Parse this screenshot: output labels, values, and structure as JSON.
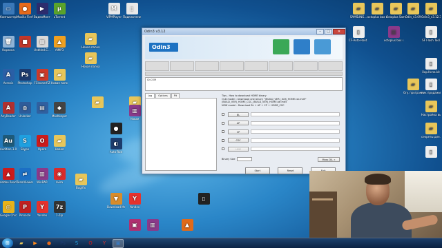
{
  "desktop": {
    "icons_left": [
      {
        "label": "Компьютер",
        "color": "#3a78b8",
        "glyph": "▭",
        "icon": "computer-icon"
      },
      {
        "label": "Mozilla Firefox",
        "color": "#e66a1b",
        "glyph": "●",
        "icon": "firefox-icon"
      },
      {
        "label": "ВидеоМонтаж",
        "color": "#2c2c6e",
        "glyph": "▶",
        "icon": "video-editor-icon"
      },
      {
        "label": "uTorrent",
        "color": "#5aa32b",
        "glyph": "µ",
        "icon": "utorrent-icon"
      },
      {
        "label": "Корзина",
        "color": "#8fb3d6",
        "glyph": "🗑",
        "icon": "recycle-bin-icon"
      },
      {
        "label": "",
        "color": "#c3372a",
        "glyph": "■",
        "icon": "app-icon"
      },
      {
        "label": "Untitled.C...",
        "color": "#d9d9d9",
        "glyph": "▦",
        "icon": "document-icon"
      },
      {
        "label": "AIMP3",
        "color": "#f0a020",
        "glyph": "▲",
        "icon": "aimp-icon"
      },
      {
        "label": "Acronis",
        "color": "#2a5fa6",
        "glyph": "A",
        "icon": "acronis-icon"
      },
      {
        "label": "Photoshop",
        "color": "#1d3a6e",
        "glyph": "Ps",
        "icon": "photoshop-icon"
      },
      {
        "label": "FCleanerRZ",
        "color": "#cc3a2a",
        "glyph": "▣",
        "icon": "cleaner-icon"
      },
      {
        "label": "Новая папка",
        "color": "#e8c65a",
        "glyph": "▰",
        "icon": "folder-icon"
      },
      {
        "label": "AnyReader",
        "color": "#b03030",
        "glyph": "A",
        "icon": "reader-icon"
      },
      {
        "label": "Unlocker",
        "color": "#2e5c9a",
        "glyph": "◍",
        "icon": "unlocker-icon"
      },
      {
        "label": "",
        "color": "#3060a0",
        "glyph": "▤",
        "icon": "monitor-icon"
      },
      {
        "label": "MacKeeper",
        "color": "#444",
        "glyph": "◆",
        "icon": "mackeeper-icon"
      },
      {
        "label": "Audition 3.0",
        "color": "#1e5a7a",
        "glyph": "Au",
        "icon": "audition-icon"
      },
      {
        "label": "Skype",
        "color": "#1fa0e0",
        "glyph": "S",
        "icon": "skype-icon"
      },
      {
        "label": "Opera",
        "color": "#cc1b1b",
        "glyph": "O",
        "icon": "opera-icon"
      },
      {
        "label": "Новая",
        "color": "#e8c65a",
        "glyph": "▰",
        "icon": "folder-icon"
      },
      {
        "label": "Adobe Reader",
        "color": "#cc1b1b",
        "glyph": "▲",
        "icon": "adobe-reader-icon"
      },
      {
        "label": "TeamViewer",
        "color": "#1c6fc4",
        "glyph": "⇄",
        "icon": "teamviewer-icon"
      },
      {
        "label": "WinRAR",
        "color": "#8a3a8a",
        "glyph": "▥",
        "icon": "winrar-icon"
      },
      {
        "label": "Avira",
        "color": "#d92b2b",
        "glyph": "◉",
        "icon": "avira-icon"
      },
      {
        "label": "Google Chrome",
        "color": "#e8b21a",
        "glyph": "◎",
        "icon": "chrome-icon"
      },
      {
        "label": "Pinnacle",
        "color": "#c02020",
        "glyph": "P",
        "icon": "pinnacle-icon"
      },
      {
        "label": "Yandex",
        "color": "#e5322d",
        "glyph": "Y",
        "icon": "yandex-icon"
      },
      {
        "label": "7-Zip",
        "color": "#333",
        "glyph": "7z",
        "icon": "seven-zip-icon"
      }
    ],
    "icons_right": [
      {
        "label": "SAMSUNG...",
        "color": "#e8c65a",
        "glyph": "▰",
        "icon": "folder-icon"
      },
      {
        "label": "octoplus box crack by No...",
        "color": "#e8c65a",
        "glyph": "▰",
        "icon": "folder-icon"
      },
      {
        "label": "Octoplus Samsu...",
        "color": "#e8c65a",
        "glyph": "▰",
        "icon": "folder-icon"
      },
      {
        "label": "Odin_v3.09",
        "color": "#e8c65a",
        "glyph": "▰",
        "icon": "folder-icon"
      },
      {
        "label": "Odin3_v3.12.3",
        "color": "#e8c65a",
        "glyph": "▰",
        "icon": "folder-icon"
      },
      {
        "label": "CF-Auto-Root...",
        "color": "#eee",
        "glyph": "▯",
        "icon": "file-icon"
      },
      {
        "label": "octoplus box crack by No...",
        "color": "#8a3a8a",
        "glyph": "▥",
        "icon": "winrar-icon"
      },
      {
        "label": "SF Flash Tool",
        "color": "#eee",
        "glyph": "▯",
        "icon": "file-icon"
      },
      {
        "label": "Хар.Нича.kit",
        "color": "#eee",
        "glyph": "▯",
        "icon": "file-icon"
      },
      {
        "label": "Gry. программ",
        "color": "#e8c65a",
        "glyph": "▰",
        "icon": "folder-icon"
      },
      {
        "label": "пиx продажи",
        "color": "#eee",
        "glyph": "▯",
        "icon": "file-icon"
      },
      {
        "label": "Настройка выкуп.txt",
        "color": "#e8c65a",
        "glyph": "▰",
        "icon": "folder-icon"
      },
      {
        "label": "секреты для...",
        "color": "#e8c65a",
        "glyph": "▰",
        "icon": "folder-icon"
      },
      {
        "label": "",
        "color": "#eee",
        "glyph": "▯",
        "icon": "file-icon"
      }
    ],
    "icons_middle": [
      {
        "label": "ViPMPlayer",
        "color": "#e8e8e8",
        "glyph": "M",
        "icon": "player-icon"
      },
      {
        "label": "Подключение...",
        "color": "#e8e8e8",
        "glyph": "▯",
        "icon": "connection-icon"
      },
      {
        "label": "Новая папка",
        "color": "#e8c65a",
        "glyph": "▰",
        "icon": "folder-icon"
      },
      {
        "label": "Новая папка",
        "color": "#e8c65a",
        "glyph": "▰",
        "icon": "folder-icon"
      },
      {
        "label": "",
        "color": "#e8c65a",
        "glyph": "▰",
        "icon": "folder-icon"
      },
      {
        "label": "",
        "color": "#e8c65a",
        "glyph": "▰",
        "icon": "folder-icon"
      },
      {
        "label": "Новая",
        "color": "#8a3a8a",
        "glyph": "▥",
        "icon": "winrar-icon"
      },
      {
        "label": "",
        "color": "#222",
        "glyph": "●",
        "icon": "camera-icon"
      },
      {
        "label": "Auto Run",
        "color": "#1c3c6c",
        "glyph": "◐",
        "icon": "autorun-icon"
      },
      {
        "label": "Bug/fix",
        "color": "#e8c65a",
        "glyph": "▰",
        "icon": "folder-icon"
      },
      {
        "label": "Download Master",
        "color": "#d88c2a",
        "glyph": "▼",
        "icon": "download-master-icon"
      },
      {
        "label": "Yandex",
        "color": "#e5322d",
        "glyph": "Y",
        "icon": "yandex-icon"
      },
      {
        "label": "",
        "color": "#222",
        "glyph": "▯",
        "icon": "file-icon"
      },
      {
        "label": "",
        "color": "#b03070",
        "glyph": "▣",
        "icon": "image-icon"
      },
      {
        "label": "",
        "color": "#8a3a8a",
        "glyph": "▥",
        "icon": "winrar-icon"
      },
      {
        "label": "",
        "color": "#e06a1a",
        "glyph": "▲",
        "icon": "vlc-icon"
      }
    ]
  },
  "odin": {
    "title": "Odin3 v3.12",
    "logo": "Odin3",
    "id_com_label": "ID:COM",
    "tabs": [
      "Log",
      "Options",
      "Pit"
    ],
    "tips": [
      "Tips - How to download HOME binary",
      "OLD model : Download one binary   \"(BUILD_VER)_XXX_HOME.tar.md5\"",
      "NEW model : Download BL + AP + CP + HOME_CSC"
    ],
    "tips_line2": "        (BUILD_VER)_HOME_CSC_(BUILD_VER)_HOME.tar.md5",
    "file_buttons": [
      {
        "label": "BL",
        "enabled": true
      },
      {
        "label": "AP",
        "enabled": true
      },
      {
        "label": "CP",
        "enabled": true
      },
      {
        "label": "CSC",
        "enabled": true
      },
      {
        "label": "UMS",
        "enabled": false
      }
    ],
    "binary_size_label": "Binary Size",
    "mass_dl_label": "Mass D/L »",
    "start_label": "Start",
    "reset_label": "Reset",
    "exit_label": "Exit"
  },
  "taskbar": {
    "apps": [
      {
        "icon": "explorer-icon",
        "glyph": "▰",
        "color": "#e8c65a",
        "active": false
      },
      {
        "icon": "media-player-icon",
        "glyph": "▶",
        "color": "#ff8a1c",
        "active": false
      },
      {
        "icon": "firefox-icon",
        "glyph": "●",
        "color": "#e66a1b",
        "active": false
      },
      {
        "icon": "photoshop-icon",
        "glyph": "Ps",
        "color": "#1d3a6e",
        "active": false
      },
      {
        "icon": "skype-icon",
        "glyph": "S",
        "color": "#1fa0e0",
        "active": false
      },
      {
        "icon": "opera-icon",
        "glyph": "O",
        "color": "#cc1b1b",
        "active": false
      },
      {
        "icon": "yandex-icon",
        "glyph": "Y",
        "color": "#e5322d",
        "active": false
      },
      {
        "icon": "odin-icon",
        "glyph": "▣",
        "color": "#3a7ac0",
        "active": true
      }
    ]
  }
}
